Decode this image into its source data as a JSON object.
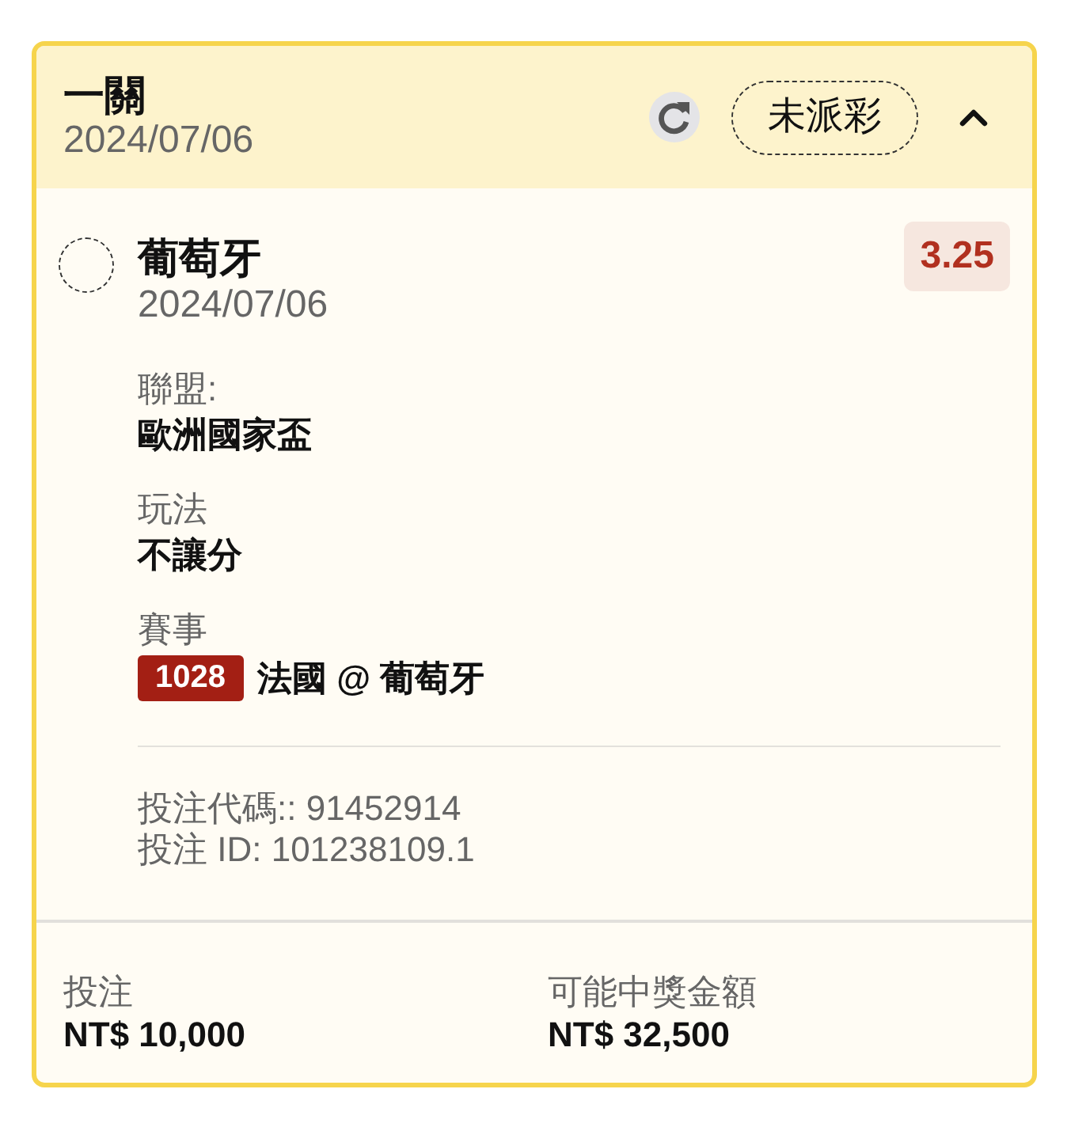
{
  "bet": {
    "title": "一關",
    "date": "2024/07/06",
    "status": "未派彩",
    "expanded": true
  },
  "selections": [
    {
      "name": "葡萄牙",
      "date": "2024/07/06",
      "odds": "3.25",
      "details": [
        {
          "kind": "text",
          "label": "聯盟:",
          "value": "歐洲國家盃"
        },
        {
          "kind": "text",
          "label": "玩法",
          "value": "不讓分"
        },
        {
          "kind": "event",
          "label": "賽事",
          "code": "1028",
          "value": "法國 @ 葡萄牙"
        }
      ],
      "bet_code": "投注代碼:: 91452914",
      "bet_id": "投注 ID: 101238109.1"
    }
  ],
  "summary": [
    {
      "label": "投注",
      "value": "NT$ 10,000"
    },
    {
      "label": "可能中獎金額",
      "value": "NT$ 32,500"
    }
  ]
}
